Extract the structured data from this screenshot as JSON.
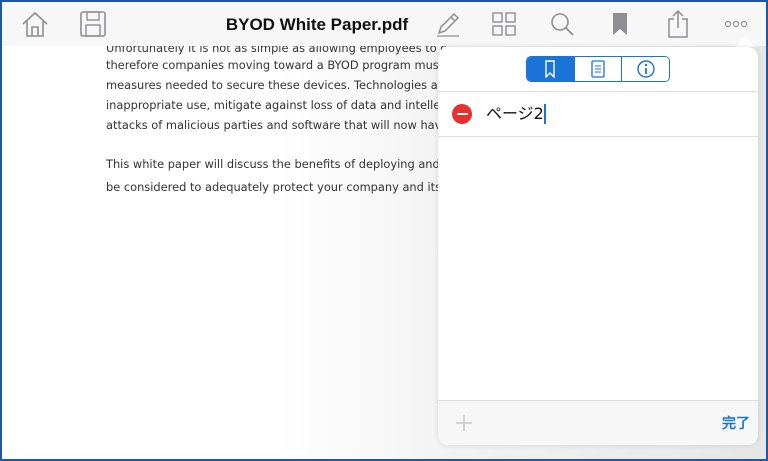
{
  "toolbar": {
    "title": "BYOD White Paper.pdf",
    "icons": [
      "home-icon",
      "save-icon",
      "pencil-icon",
      "grid-icon",
      "search-icon",
      "bookmark-icon",
      "share-icon",
      "more-icon"
    ]
  },
  "document": {
    "lines": [
      "Unfortunately it is not as simple as allowing employees to conn",
      "therefore companies moving toward a BYOD program must u",
      "measures needed to secure these devices. Technologies and",
      "inappropriate use, mitigate against loss of data and intellectu",
      "attacks of malicious parties and software that will now have r",
      "This white paper will discuss the benefits of deploying and en",
      "be considered to adequately protect your company and its cr"
    ]
  },
  "popover": {
    "tabs": [
      "bookmarks-tab",
      "outline-tab",
      "info-tab"
    ],
    "active_tab": "bookmarks-tab",
    "bookmark": {
      "value": "ページ2"
    },
    "done_label": "完了"
  },
  "colors": {
    "accent": "#1a73d9",
    "delete": "#e5322d",
    "frame": "#1f57a6",
    "icon_gray": "#8e8e93"
  }
}
